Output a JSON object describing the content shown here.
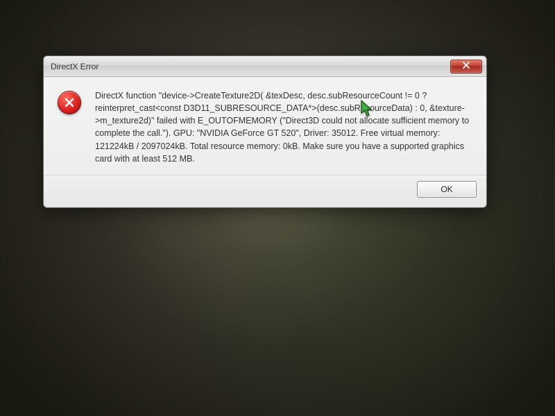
{
  "dialog": {
    "title": "DirectX Error",
    "message": "DirectX function \"device->CreateTexture2D( &texDesc, desc.subResourceCount != 0 ? reinterpret_cast<const D3D11_SUBRESOURCE_DATA*>(desc.subResourceData) : 0, &texture->m_texture2d)\" failed with E_OUTOFMEMORY (\"Direct3D could not allocate sufficient memory to complete the call.\"). GPU: \"NVIDIA GeForce GT 520\", Driver: 35012. Free virtual memory: 121224kB / 2097024kB. Total resource memory: 0kB. Make sure you have a supported graphics card with at least 512 MB.",
    "ok_label": "OK"
  }
}
